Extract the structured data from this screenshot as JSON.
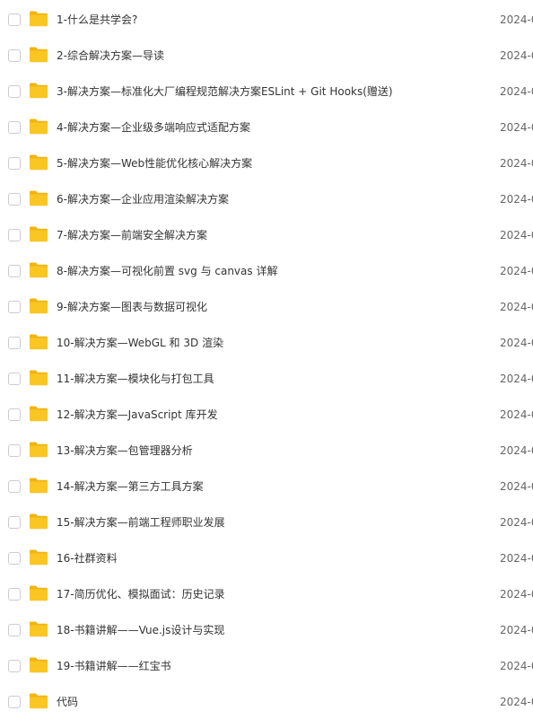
{
  "colors": {
    "folder": "#f9c624",
    "folder_dark": "#f0b415",
    "text": "#333333",
    "date_text": "#666666",
    "checkbox_border": "#c9ccd2"
  },
  "icons": {
    "row_checkbox": "checkbox",
    "row_icon": "folder-icon"
  },
  "files": [
    {
      "name": "1-什么是共学会?",
      "date": "2024-0"
    },
    {
      "name": "2-综合解决方案—导读",
      "date": "2024-0"
    },
    {
      "name": "3-解决方案—标准化大厂编程规范解决方案ESLint + Git Hooks(赠送)",
      "date": "2024-0"
    },
    {
      "name": "4-解决方案—企业级多端响应式适配方案",
      "date": "2024-0"
    },
    {
      "name": "5-解决方案—Web性能优化核心解决方案",
      "date": "2024-0"
    },
    {
      "name": "6-解决方案—企业应用渲染解决方案",
      "date": "2024-0"
    },
    {
      "name": "7-解决方案—前端安全解决方案",
      "date": "2024-0"
    },
    {
      "name": "8-解决方案—可视化前置 svg 与 canvas 详解",
      "date": "2024-0"
    },
    {
      "name": "9-解决方案—图表与数据可视化",
      "date": "2024-0"
    },
    {
      "name": "10-解决方案—WebGL 和 3D 渲染",
      "date": "2024-0"
    },
    {
      "name": "11-解决方案—模块化与打包工具",
      "date": "2024-0"
    },
    {
      "name": "12-解决方案—JavaScript 库开发",
      "date": "2024-0"
    },
    {
      "name": "13-解决方案—包管理器分析",
      "date": "2024-0"
    },
    {
      "name": "14-解决方案—第三方工具方案",
      "date": "2024-0"
    },
    {
      "name": "15-解决方案—前端工程师职业发展",
      "date": "2024-0"
    },
    {
      "name": "16-社群资料",
      "date": "2024-0"
    },
    {
      "name": "17-简历优化、模拟面试：历史记录",
      "date": "2024-0"
    },
    {
      "name": "18-书籍讲解——Vue.js设计与实现",
      "date": "2024-0"
    },
    {
      "name": "19-书籍讲解——红宝书",
      "date": "2024-0"
    },
    {
      "name": "代码",
      "date": "2024-0"
    }
  ]
}
